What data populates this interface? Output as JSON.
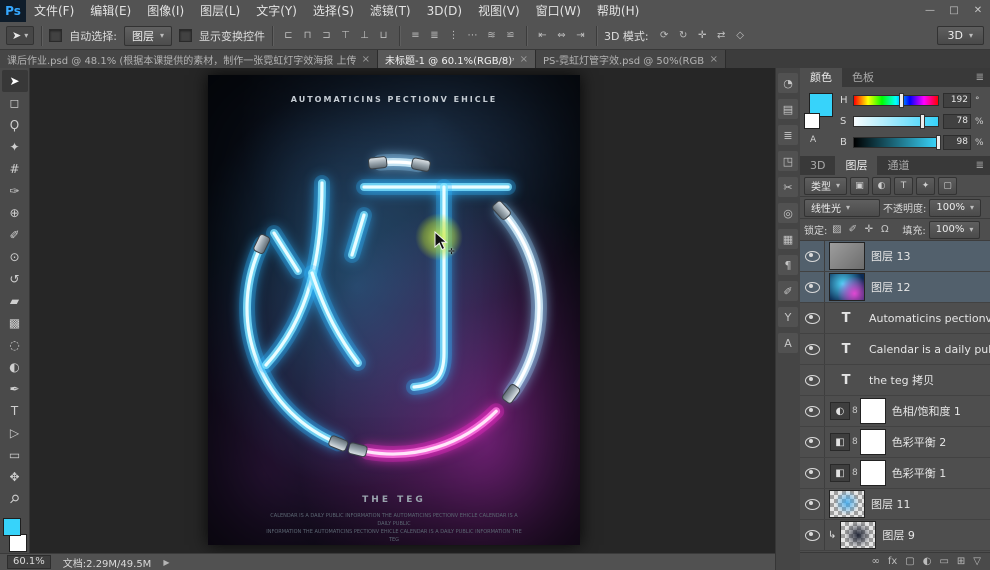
{
  "ui": {
    "caret": "▾"
  },
  "window": {
    "logo": "Ps",
    "controls": [
      {
        "glyph": "—",
        "name": "minimize-button"
      },
      {
        "glyph": "□",
        "name": "maximize-button"
      },
      {
        "glyph": "✕",
        "name": "close-button"
      }
    ]
  },
  "menubar": {
    "items": [
      "文件(F)",
      "编辑(E)",
      "图像(I)",
      "图层(L)",
      "文字(Y)",
      "选择(S)",
      "滤镜(T)",
      "3D(D)",
      "视图(V)",
      "窗口(W)",
      "帮助(H)"
    ]
  },
  "options_bar": {
    "tool_glyph": "➤",
    "auto_select_label": "自动选择:",
    "auto_select_value": "图层",
    "show_transform_label": "显示变换控件",
    "align_icons": [
      "⊏",
      "⊓",
      "⊐",
      "⊤",
      "⊥",
      "⊔"
    ],
    "distribute_icons": [
      "≡",
      "≣",
      "⋮",
      "⋯",
      "≋",
      "≌"
    ],
    "spacing_icons": [
      "⇤",
      "⇔",
      "⇥"
    ],
    "mode_3d_label": "3D 模式:",
    "mode_3d_icons": [
      "⟳",
      "↻",
      "✛",
      "⇄",
      "◇"
    ],
    "workspace_label": "3D"
  },
  "tabs": [
    {
      "label": "课后作业.psd @ 48.1% (根据本课提供的素材，制作一张霓虹灯字效海报 上传...",
      "close": "×",
      "mod": ""
    },
    {
      "label": "未标题-1 @ 60.1%(RGB/8)*",
      "close": "×",
      "mod": "active"
    },
    {
      "label": "PS-霓虹灯管字效.psd @ 50%(RGB/...",
      "close": "×",
      "mod": ""
    }
  ],
  "toolbar": {
    "foreground_color": "#37d3fa",
    "background_color": "#ffffff",
    "tools": [
      {
        "glyph": "➤",
        "name": "move-tool",
        "mod": "active"
      },
      {
        "glyph": "◻",
        "name": "rectangular-marquee-tool"
      },
      {
        "glyph": "Ϙ",
        "name": "lasso-tool"
      },
      {
        "glyph": "✦",
        "name": "quick-selection-tool"
      },
      {
        "glyph": "#",
        "name": "crop-tool"
      },
      {
        "glyph": "✑",
        "name": "eyedropper-tool"
      },
      {
        "glyph": "⊕",
        "name": "healing-brush-tool"
      },
      {
        "glyph": "✐",
        "name": "brush-tool"
      },
      {
        "glyph": "⊙",
        "name": "clone-stamp-tool"
      },
      {
        "glyph": "↺",
        "name": "history-brush-tool"
      },
      {
        "glyph": "▰",
        "name": "eraser-tool"
      },
      {
        "glyph": "▩",
        "name": "gradient-tool"
      },
      {
        "glyph": "◌",
        "name": "blur-tool"
      },
      {
        "glyph": "◐",
        "name": "dodge-tool"
      },
      {
        "glyph": "✒",
        "name": "pen-tool"
      },
      {
        "glyph": "T",
        "name": "type-tool"
      },
      {
        "glyph": "▷",
        "name": "path-selection-tool"
      },
      {
        "glyph": "▭",
        "name": "rectangle-tool"
      },
      {
        "glyph": "✥",
        "name": "hand-tool"
      },
      {
        "glyph": "⚲",
        "name": "zoom-tool",
        "mod": "rot"
      }
    ]
  },
  "poster": {
    "title": "AUTOMATICINS PECTIONV EHICLE",
    "character": "灯",
    "subtitle": "THE TEG",
    "neon_cyan": "#3ec9ff",
    "neon_pink": "#ff3fd1",
    "fine_print": [
      "CALENDAR IS A DAILY PUBLIC INFORMATION THE AUTOMATICINS PECTIONV EHICLE CALENDAR IS A DAILY PUBLIC",
      "INFORMATION THE AUTOMATICINS PECTIONV EHICLE CALENDAR IS A DAILY PUBLIC INFORMATION THE TEG"
    ]
  },
  "panel_strip": {
    "icons": [
      {
        "glyph": "◔",
        "name": "history-panel-icon"
      },
      {
        "glyph": "▤",
        "name": "adjustments-panel-icon"
      },
      {
        "glyph": "≣",
        "name": "properties-panel-icon"
      },
      {
        "glyph": "◳",
        "name": "info-panel-icon"
      },
      {
        "glyph": "✂",
        "name": "slice-panel-icon"
      },
      {
        "glyph": "◎",
        "name": "3d-panel-icon"
      },
      {
        "glyph": "▦",
        "name": "channels-panel-icon"
      },
      {
        "glyph": "¶",
        "name": "paragraph-panel-icon"
      },
      {
        "glyph": "✐",
        "name": "brush-panel-icon"
      },
      {
        "glyph": "Y",
        "name": "clone-source-panel-icon"
      },
      {
        "glyph": "A",
        "name": "character-panel-icon"
      }
    ]
  },
  "color_panel": {
    "tabs": [
      {
        "label": "颜色",
        "mod": "active"
      },
      {
        "label": "色板",
        "mod": ""
      }
    ],
    "menu_icon": "≣",
    "foreground_color": "#37d3fa",
    "ramp_icon": "A",
    "sliders": [
      {
        "label": "H",
        "value": "192",
        "unit": "°"
      },
      {
        "label": "S",
        "value": "78",
        "unit": "%"
      },
      {
        "label": "B",
        "value": "98",
        "unit": "%"
      }
    ]
  },
  "layers_panel": {
    "tabs": [
      {
        "label": "3D",
        "mod": ""
      },
      {
        "label": "图层",
        "mod": "active"
      },
      {
        "label": "通道",
        "mod": ""
      }
    ],
    "menu_icon": "≣",
    "filter_label": "类型",
    "filter_icons": [
      {
        "glyph": "▣",
        "name": "filter-pixel-layers-icon"
      },
      {
        "glyph": "◐",
        "name": "filter-adjustment-layers-icon"
      },
      {
        "glyph": "T",
        "name": "filter-type-layers-icon"
      },
      {
        "glyph": "✦",
        "name": "filter-shape-layers-icon"
      },
      {
        "glyph": "▢",
        "name": "filter-smart-objects-icon"
      }
    ],
    "blend_mode": "线性光",
    "opacity_label": "不透明度:",
    "opacity_value": "100%",
    "lock_label": "锁定:",
    "lock_icons": [
      {
        "glyph": "▨",
        "name": "lock-transparency-icon"
      },
      {
        "glyph": "✐",
        "name": "lock-pixels-icon"
      },
      {
        "glyph": "✛",
        "name": "lock-position-icon"
      },
      {
        "glyph": "Ω",
        "name": "lock-all-icon"
      }
    ],
    "fill_label": "填充:",
    "fill_value": "100%",
    "link_glyph": "8",
    "clip_glyph": "↳",
    "layers": [
      {
        "name": "图层 13"
      },
      {
        "name": "图层 12"
      },
      {
        "name": "Automaticins pectionv eh...",
        "icon": "T"
      },
      {
        "name": "Calendar is a daily public...",
        "icon": "T"
      },
      {
        "name": "the teg 拷贝",
        "icon": "T"
      },
      {
        "name": "色相/饱和度 1",
        "icon": "◐"
      },
      {
        "name": "色彩平衡 2",
        "icon": "◧"
      },
      {
        "name": "色彩平衡 1",
        "icon": "◧"
      },
      {
        "name": "图层 11"
      },
      {
        "name": "图层 9"
      }
    ],
    "footer_icons": [
      {
        "glyph": "∞",
        "name": "link-layers-icon"
      },
      {
        "glyph": "fx",
        "name": "layer-effects-icon"
      },
      {
        "glyph": "▢",
        "name": "add-mask-icon"
      },
      {
        "glyph": "◐",
        "name": "new-adjustment-layer-icon"
      },
      {
        "glyph": "▭",
        "name": "new-group-icon"
      },
      {
        "glyph": "⊞",
        "name": "new-layer-icon"
      },
      {
        "glyph": "▽",
        "name": "delete-layer-icon"
      }
    ]
  },
  "status_bar": {
    "zoom": "60.1%",
    "doc_info": "文档:2.29M/49.5M",
    "arrow": "▶"
  }
}
